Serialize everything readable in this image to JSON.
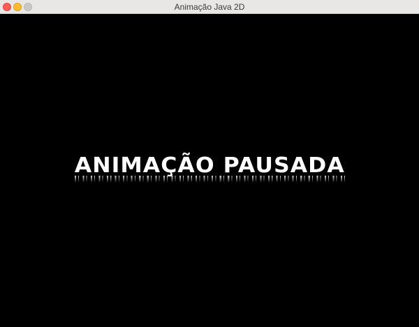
{
  "window": {
    "title": "Animação Java 2D",
    "controls": {
      "close": "close-icon",
      "minimize": "minimize-icon",
      "zoom": "zoom-icon",
      "colors": {
        "close": "#ff5f57",
        "minimize": "#febc2e",
        "zoom": "#c8c8c8"
      }
    }
  },
  "canvas": {
    "background": "#000000",
    "message": "ANIMAÇÃO PAUSADA",
    "message_color": "#ffffff"
  }
}
